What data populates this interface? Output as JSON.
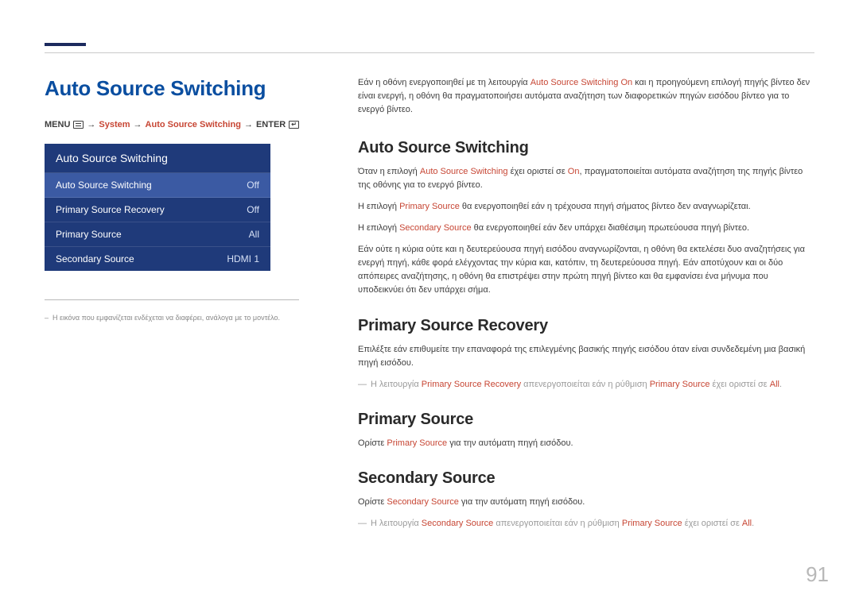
{
  "page_number": "91",
  "left": {
    "title": "Auto Source Switching",
    "breadcrumb": {
      "menu": "MENU",
      "system": "System",
      "auto": "Auto Source Switching",
      "enter": "ENTER"
    },
    "menu": {
      "header": "Auto Source Switching",
      "rows": [
        {
          "label": "Auto Source Switching",
          "value": "Off",
          "selected": true
        },
        {
          "label": "Primary Source Recovery",
          "value": "Off",
          "selected": false
        },
        {
          "label": "Primary Source",
          "value": "All",
          "selected": false
        },
        {
          "label": "Secondary Source",
          "value": "HDMI 1",
          "selected": false
        }
      ]
    },
    "footnote_dash": "–",
    "footnote": "Η εικόνα που εμφανίζεται ενδέχεται να διαφέρει, ανάλογα με το μοντέλο."
  },
  "right": {
    "intro": {
      "p1a": "Εάν η οθόνη ενεργοποιηθεί με τη λειτουργία ",
      "p1_red": "Auto Source Switching On",
      "p1b": " και η προηγούμενη επιλογή πηγής βίντεο δεν είναι ενεργή, η οθόνη θα πραγματοποιήσει αυτόματα αναζήτηση των διαφορετικών πηγών εισόδου βίντεο για το ενεργό βίντεο."
    },
    "sec1": {
      "heading": "Auto Source Switching",
      "p1a": "Όταν η επιλογή ",
      "p1_red1": "Auto Source Switching",
      "p1b": " έχει οριστεί σε ",
      "p1_red2": "On",
      "p1c": ", πραγματοποιείται αυτόματα αναζήτηση της πηγής βίντεο της οθόνης για το ενεργό βίντεο.",
      "p2a": "Η επιλογή ",
      "p2_red": "Primary Source",
      "p2b": " θα ενεργοποιηθεί εάν η τρέχουσα πηγή σήματος βίντεο δεν αναγνωρίζεται.",
      "p3a": "Η επιλογή ",
      "p3_red": "Secondary Source",
      "p3b": " θα ενεργοποιηθεί εάν δεν υπάρχει διαθέσιμη πρωτεύουσα πηγή βίντεο.",
      "p4": "Εάν ούτε η κύρια ούτε και η δευτερεύουσα πηγή εισόδου αναγνωρίζονται, η οθόνη θα εκτελέσει δυο αναζητήσεις για ενεργή πηγή, κάθε φορά ελέγχοντας την κύρια και, κατόπιν, τη δευτερεύουσα πηγή. Εάν αποτύχουν και οι δύο απόπειρες αναζήτησης, η οθόνη θα επιστρέψει στην πρώτη πηγή βίντεο και θα εμφανίσει ένα μήνυμα που υποδεικνύει ότι δεν υπάρχει σήμα."
    },
    "sec2": {
      "heading": "Primary Source Recovery",
      "p1": "Επιλέξτε εάν επιθυμείτε την επαναφορά της επιλεγμένης βασικής πηγής εισόδου όταν είναι συνδεδεμένη μια βασική πηγή εισόδου.",
      "note_dash": "―",
      "note_a": "Η λειτουργία ",
      "note_red1": "Primary Source Recovery",
      "note_b": " απενεργοποιείται εάν η ρύθμιση ",
      "note_red2": "Primary Source",
      "note_c": " έχει οριστεί σε ",
      "note_red3": "All",
      "note_d": "."
    },
    "sec3": {
      "heading": "Primary Source",
      "p1a": "Ορίστε ",
      "p1_red": "Primary Source",
      "p1b": " για την αυτόματη πηγή εισόδου."
    },
    "sec4": {
      "heading": "Secondary Source",
      "p1a": "Ορίστε ",
      "p1_red": "Secondary Source",
      "p1b": " για την αυτόματη πηγή εισόδου.",
      "note_dash": "―",
      "note_a": "Η λειτουργία ",
      "note_red1": "Secondary Source",
      "note_b": " απενεργοποιείται εάν η ρύθμιση ",
      "note_red2": "Primary Source",
      "note_c": " έχει οριστεί σε ",
      "note_red3": "All",
      "note_d": "."
    }
  }
}
